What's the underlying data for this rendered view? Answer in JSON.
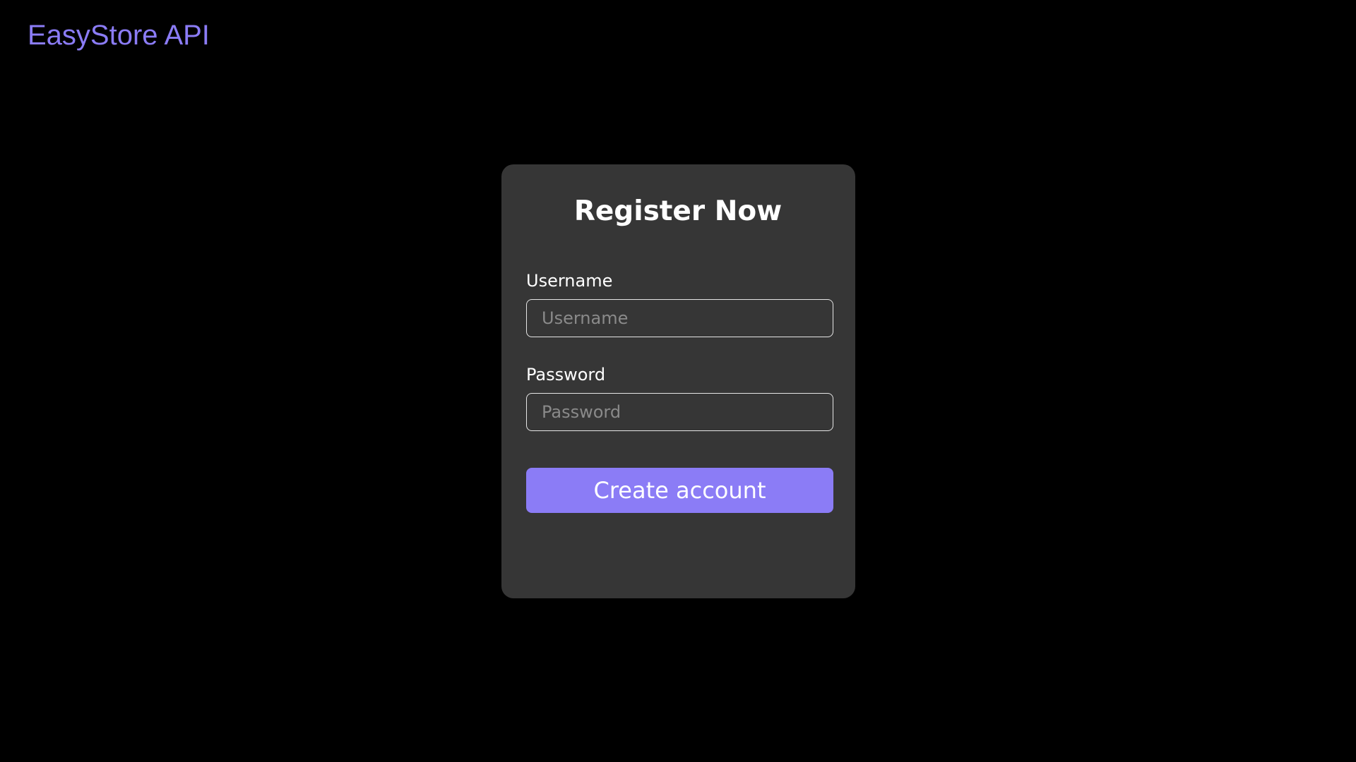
{
  "header": {
    "brand": "EasyStore API"
  },
  "form": {
    "title": "Register Now",
    "username": {
      "label": "Username",
      "placeholder": "Username",
      "value": ""
    },
    "password": {
      "label": "Password",
      "placeholder": "Password",
      "value": ""
    },
    "submit_label": "Create account"
  },
  "colors": {
    "accent": "#8b7cf6",
    "background": "#000000",
    "card": "#363636",
    "text": "#ffffff",
    "placeholder": "#8a8a8a"
  }
}
